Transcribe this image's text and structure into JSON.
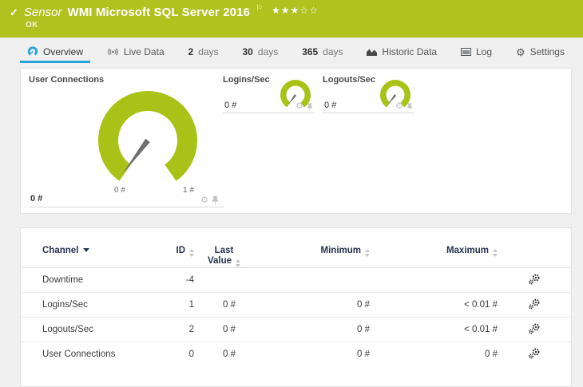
{
  "header": {
    "status_icon": "✓",
    "kind": "Sensor",
    "title": "WMI Microsoft SQL Server 2016",
    "flag_icon": "⚐",
    "stars_filled": "★★★",
    "stars_empty": "☆☆",
    "status": "OK"
  },
  "tabs": {
    "overview": "Overview",
    "live_data": "Live Data",
    "d2_num": "2",
    "d2_label": "days",
    "d30_num": "30",
    "d30_label": "days",
    "d365_num": "365",
    "d365_label": "days",
    "historic": "Historic Data",
    "log": "Log",
    "settings": "Settings"
  },
  "gauges": {
    "user_connections": {
      "title": "User Connections",
      "value": "0 #",
      "scale_min": "0 #",
      "scale_max": "1 #"
    },
    "logins": {
      "title": "Logins/Sec",
      "value": "0 #"
    },
    "logouts": {
      "title": "Logouts/Sec",
      "value": "0 #"
    }
  },
  "table": {
    "headers": {
      "channel": "Channel",
      "id": "ID",
      "last_value": "Last Value",
      "minimum": "Minimum",
      "maximum": "Maximum"
    },
    "rows": [
      {
        "channel": "Downtime",
        "id": "-4",
        "last": "",
        "min": "",
        "max": ""
      },
      {
        "channel": "Logins/Sec",
        "id": "1",
        "last": "0 #",
        "min": "0 #",
        "max": "< 0.01 #"
      },
      {
        "channel": "Logouts/Sec",
        "id": "2",
        "last": "0 #",
        "min": "0 #",
        "max": "< 0.01 #"
      },
      {
        "channel": "User Connections",
        "id": "0",
        "last": "0 #",
        "min": "0 #",
        "max": "0 #"
      }
    ]
  },
  "icons": {
    "gear": "⚙"
  },
  "colors": {
    "header_bg": "#b0c120",
    "gauge_green": "#a9c217",
    "accent_blue": "#2aa3db"
  }
}
